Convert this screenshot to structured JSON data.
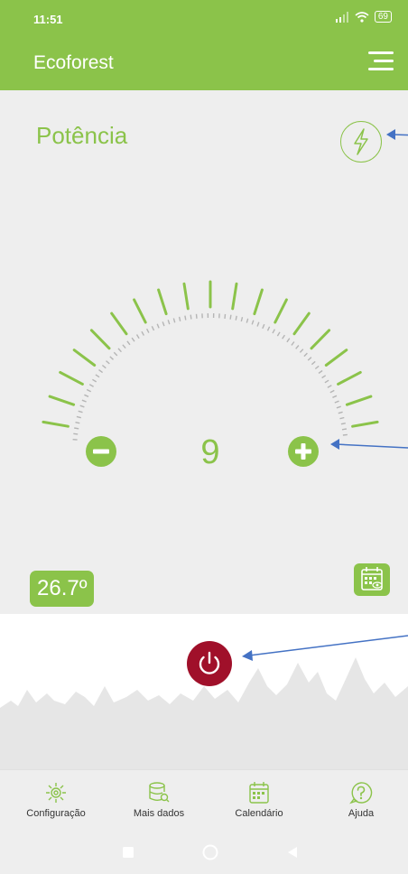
{
  "status_bar": {
    "time": "11:51",
    "battery": "69"
  },
  "header": {
    "title": "Ecoforest"
  },
  "main": {
    "section_title": "Potência",
    "power_level": 9,
    "temperature": "26.7º"
  },
  "bottom_nav": {
    "items": [
      {
        "label": "Configuração",
        "icon": "gear-icon"
      },
      {
        "label": "Mais dados",
        "icon": "database-search-icon"
      },
      {
        "label": "Calendário",
        "icon": "calendar-icon"
      },
      {
        "label": "Ajuda",
        "icon": "help-icon"
      }
    ]
  },
  "colors": {
    "accent": "#8bc34a",
    "power": "#a0102a",
    "annotation": "#4472c4"
  }
}
